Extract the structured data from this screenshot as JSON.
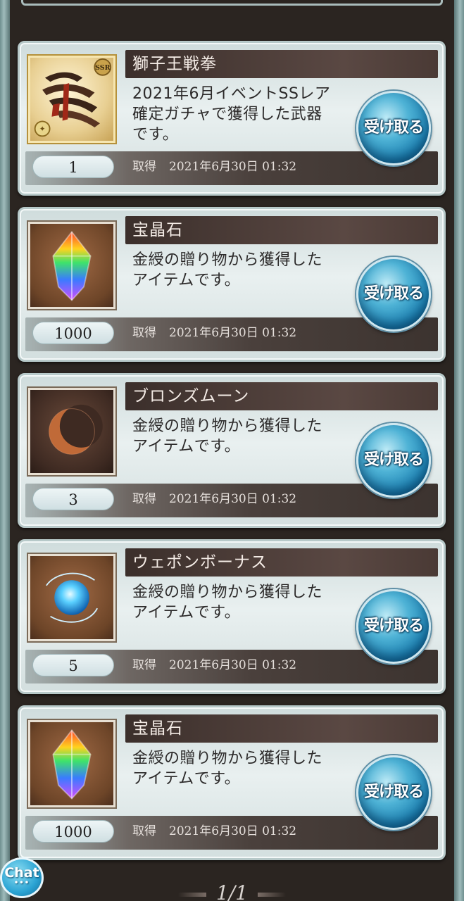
{
  "gifts": [
    {
      "title": "獅子王戦拳",
      "description_lines": [
        "2021年6月イベントSSレア",
        "確定ガチャで獲得した武器",
        "です。"
      ],
      "quantity": "1",
      "acquired_label": "取得",
      "acquired_date": "2021年6月30日 01:32",
      "receive_label": "受け取る",
      "icon": "weapon-ssr-icon",
      "badge": "SSR"
    },
    {
      "title": "宝晶石",
      "description_lines": [
        "金綬の贈り物から獲得した",
        "アイテムです。"
      ],
      "quantity": "1000",
      "acquired_label": "取得",
      "acquired_date": "2021年6月30日 01:32",
      "receive_label": "受け取る",
      "icon": "crystal-icon"
    },
    {
      "title": "ブロンズムーン",
      "description_lines": [
        "金綬の贈り物から獲得した",
        "アイテムです。"
      ],
      "quantity": "3",
      "acquired_label": "取得",
      "acquired_date": "2021年6月30日 01:32",
      "receive_label": "受け取る",
      "icon": "bronze-moon-icon"
    },
    {
      "title": "ウェポンボーナス",
      "description_lines": [
        "金綬の贈り物から獲得した",
        "アイテムです。"
      ],
      "quantity": "5",
      "acquired_label": "取得",
      "acquired_date": "2021年6月30日 01:32",
      "receive_label": "受け取る",
      "icon": "weapon-bonus-orb-icon"
    },
    {
      "title": "宝晶石",
      "description_lines": [
        "金綬の贈り物から獲得した",
        "アイテムです。"
      ],
      "quantity": "1000",
      "acquired_label": "取得",
      "acquired_date": "2021年6月30日 01:32",
      "receive_label": "受け取る",
      "icon": "crystal-icon"
    }
  ],
  "chat": {
    "label": "Chat",
    "dots": "•••"
  },
  "pagination": {
    "text": "1/1"
  },
  "colors": {
    "panel": "#e4eded",
    "title_bar": "#3b2f2b",
    "button": "#1b7fb0",
    "background": "#2b2521"
  }
}
